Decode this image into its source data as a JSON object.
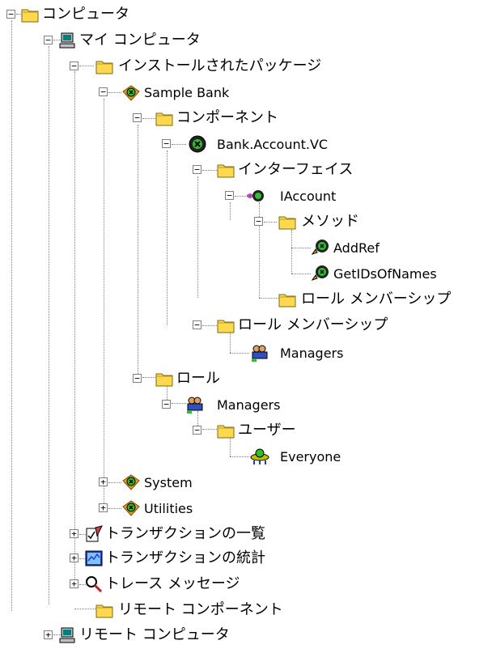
{
  "tree": {
    "root": "コンピュータ",
    "my_computer": "マイ コンピュータ",
    "installed_packages": "インストールされたパッケージ",
    "sample_bank": "Sample Bank",
    "components": "コンポーネント",
    "bank_account": "Bank.Account.VC",
    "interfaces": "インターフェイス",
    "iaccount": "IAccount",
    "methods": "メソッド",
    "addref": "AddRef",
    "getids": "GetIDsOfNames",
    "role_membership_method": "ロール メンバーシップ",
    "role_membership_component": "ロール メンバーシップ",
    "managers_member": "Managers",
    "roles": "ロール",
    "managers_role": "Managers",
    "users": "ユーザー",
    "everyone": "Everyone",
    "system": "System",
    "utilities": "Utilities",
    "tx_list": "トランザクションの一覧",
    "tx_stats": "トランザクションの統計",
    "trace_messages": "トレース メッセージ",
    "remote_components": "リモート コンポーネント",
    "remote_computers": "リモート コンピュータ"
  },
  "icons": {
    "folder": "folder-icon",
    "computer": "computer-icon",
    "package": "package-icon",
    "component": "component-icon",
    "interface": "interface-icon",
    "method": "method-icon",
    "role": "role-icon",
    "user": "user-icon",
    "tx_list": "transaction-list-icon",
    "tx_stats": "transaction-stats-icon",
    "trace": "magnifier-icon"
  },
  "expander": {
    "collapse": "−",
    "expand": "+"
  },
  "colors": {
    "folder": "#ffd84d",
    "component_green": "#2fbf2f"
  }
}
